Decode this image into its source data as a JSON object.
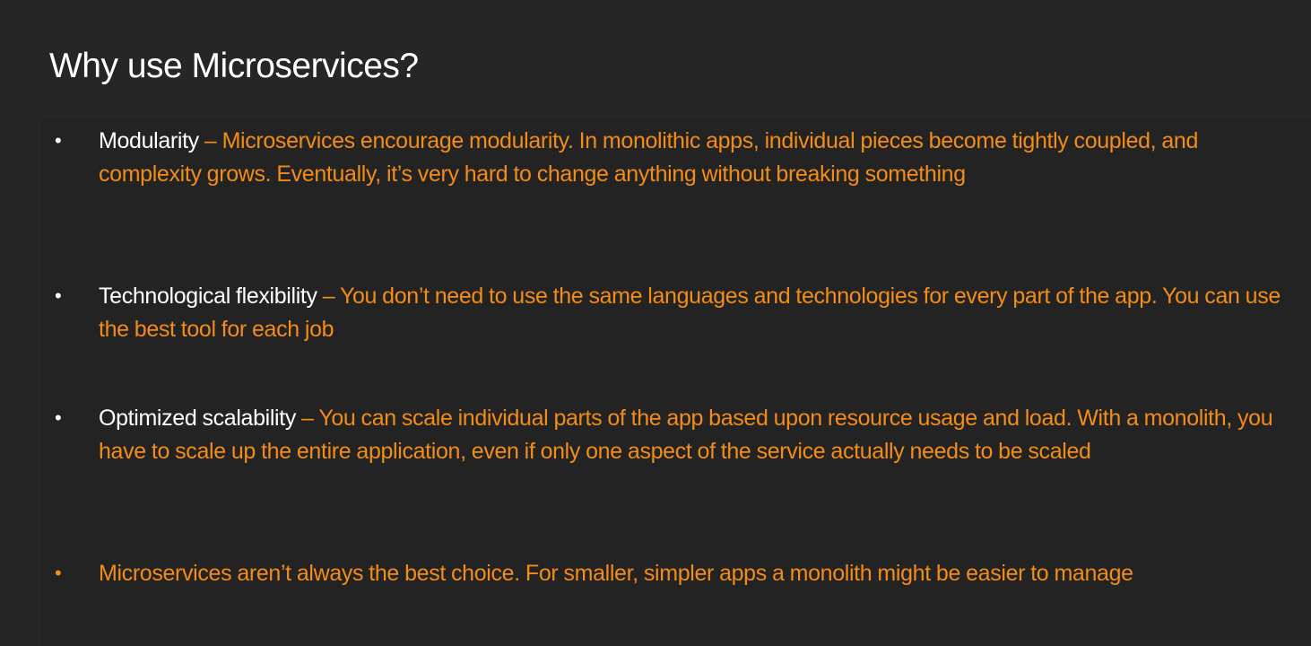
{
  "slide": {
    "title": "Why use Microservices?"
  },
  "bullets": [
    {
      "term": "Modularity",
      "separator": " – ",
      "text": "Microservices encourage modularity. In monolithic apps, individual pieces become tightly coupled, and complexity grows. Eventually, it’s very hard to change anything without breaking something",
      "bullet_symbol": "•"
    },
    {
      "term": "Technological flexibility",
      "separator": " – ",
      "text": "You don’t need to use the same languages and technologies for every part of the app. You can use the best tool for each job",
      "bullet_symbol": "•"
    },
    {
      "term": "Optimized scalability",
      "separator": " – ",
      "text": "You can scale individual parts of the app based upon resource usage and load. With a monolith, you have to scale up the entire application, even if only one aspect of the service actually needs to be scaled",
      "bullet_symbol": "•"
    },
    {
      "text": "Microservices aren’t always the best choice. For smaller, simpler apps a monolith might be easier to manage",
      "bullet_symbol": "•"
    }
  ],
  "colors": {
    "background": "#262626",
    "panel": "#232323",
    "title": "#ffffff",
    "term": "#ffffff",
    "accent": "#f28c1a"
  }
}
